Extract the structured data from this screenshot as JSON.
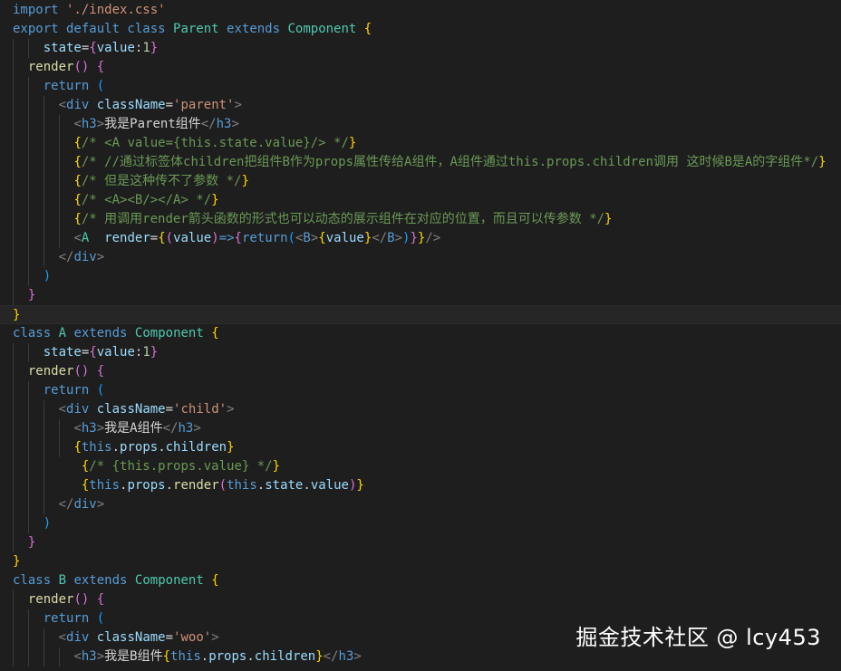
{
  "editor": {
    "colors": {
      "background": "#1e1e1e",
      "keyword": "#569cd6",
      "class": "#4ec9b0",
      "function": "#dcdcaa",
      "variable": "#9cdcfe",
      "number": "#b5cea8",
      "string": "#ce9178",
      "comment": "#6a9955",
      "bracket_gold": "#ffd700",
      "bracket_purple": "#da70d6",
      "bracket_blue": "#179fff"
    },
    "lines": [
      {
        "indent": 0,
        "tokens": [
          [
            "keyword",
            "import"
          ],
          [
            "text",
            " "
          ],
          [
            "str",
            "'./index.css'"
          ]
        ]
      },
      {
        "indent": 0,
        "tokens": [
          [
            "keyword",
            "export default class"
          ],
          [
            "text",
            " "
          ],
          [
            "class",
            "Parent"
          ],
          [
            "text",
            " "
          ],
          [
            "keyword",
            "extends"
          ],
          [
            "text",
            " "
          ],
          [
            "class",
            "Component"
          ],
          [
            "text",
            " "
          ],
          [
            "brace1",
            "{"
          ]
        ]
      },
      {
        "indent": 2,
        "tokens": [
          [
            "var",
            "state"
          ],
          [
            "op",
            "="
          ],
          [
            "brace2",
            "{"
          ],
          [
            "var",
            "value"
          ],
          [
            "op",
            ":"
          ],
          [
            "num",
            "1"
          ],
          [
            "brace2",
            "}"
          ]
        ]
      },
      {
        "indent": 1,
        "tokens": [
          [
            "func",
            "render"
          ],
          [
            "brace2",
            "()"
          ],
          [
            "text",
            " "
          ],
          [
            "brace2",
            "{"
          ]
        ]
      },
      {
        "indent": 2,
        "tokens": [
          [
            "keyword",
            "return"
          ],
          [
            "text",
            " "
          ],
          [
            "brace3",
            "("
          ]
        ]
      },
      {
        "indent": 3,
        "tokens": [
          [
            "tag",
            "<"
          ],
          [
            "tagname",
            "div"
          ],
          [
            "text",
            " "
          ],
          [
            "attr",
            "className"
          ],
          [
            "op",
            "="
          ],
          [
            "str",
            "'parent'"
          ],
          [
            "tag",
            ">"
          ]
        ]
      },
      {
        "indent": 4,
        "tokens": [
          [
            "tag",
            "<"
          ],
          [
            "tagname",
            "h3"
          ],
          [
            "tag",
            ">"
          ],
          [
            "text",
            "我是Parent组件"
          ],
          [
            "tag",
            "</"
          ],
          [
            "tagname",
            "h3"
          ],
          [
            "tag",
            ">"
          ]
        ]
      },
      {
        "indent": 4,
        "tokens": [
          [
            "brace1",
            "{"
          ],
          [
            "comment",
            "/* <A value={this.state.value}/> */"
          ],
          [
            "brace1",
            "}"
          ]
        ]
      },
      {
        "indent": 4,
        "tokens": [
          [
            "brace1",
            "{"
          ],
          [
            "comment",
            "/* //通过标签体children把组件B作为props属性传给A组件，A组件通过this.props.children调用 这时候B是A的字组件*/"
          ],
          [
            "brace1",
            "}"
          ]
        ]
      },
      {
        "indent": 4,
        "tokens": [
          [
            "brace1",
            "{"
          ],
          [
            "comment",
            "/* 但是这种传不了参数 */"
          ],
          [
            "brace1",
            "}"
          ]
        ]
      },
      {
        "indent": 4,
        "tokens": [
          [
            "brace1",
            "{"
          ],
          [
            "comment",
            "/* <A><B/></A> */"
          ],
          [
            "brace1",
            "}"
          ]
        ]
      },
      {
        "indent": 4,
        "tokens": [
          [
            "brace1",
            "{"
          ],
          [
            "comment",
            "/* 用调用render箭头函数的形式也可以动态的展示组件在对应的位置，而且可以传参数 */"
          ],
          [
            "brace1",
            "}"
          ]
        ]
      },
      {
        "indent": 4,
        "tokens": [
          [
            "tag",
            "<"
          ],
          [
            "class",
            "A"
          ],
          [
            "text",
            "  "
          ],
          [
            "attr",
            "render"
          ],
          [
            "op",
            "="
          ],
          [
            "brace1",
            "{"
          ],
          [
            "brace2",
            "("
          ],
          [
            "var",
            "value"
          ],
          [
            "brace2",
            ")"
          ],
          [
            "keyword",
            "=>"
          ],
          [
            "brace2",
            "{"
          ],
          [
            "keyword",
            "return"
          ],
          [
            "brace3",
            "("
          ],
          [
            "tag",
            "<"
          ],
          [
            "tagname",
            "B"
          ],
          [
            "tag",
            ">"
          ],
          [
            "brace1",
            "{"
          ],
          [
            "var",
            "value"
          ],
          [
            "brace1",
            "}"
          ],
          [
            "tag",
            "</"
          ],
          [
            "tagname",
            "B"
          ],
          [
            "tag",
            ">"
          ],
          [
            "brace3",
            ")"
          ],
          [
            "brace2",
            "}"
          ],
          [
            "brace1",
            "}"
          ],
          [
            "tag",
            "/>"
          ]
        ]
      },
      {
        "indent": 3,
        "tokens": [
          [
            "tag",
            "</"
          ],
          [
            "tagname",
            "div"
          ],
          [
            "tag",
            ">"
          ]
        ]
      },
      {
        "indent": 2,
        "tokens": [
          [
            "brace3",
            ")"
          ]
        ]
      },
      {
        "indent": 1,
        "tokens": [
          [
            "brace2",
            "}"
          ]
        ]
      },
      {
        "indent": 0,
        "current": true,
        "tokens": [
          [
            "brace1",
            "}"
          ]
        ]
      },
      {
        "indent": 0,
        "tokens": [
          [
            "keyword",
            "class"
          ],
          [
            "text",
            " "
          ],
          [
            "class",
            "A"
          ],
          [
            "text",
            " "
          ],
          [
            "keyword",
            "extends"
          ],
          [
            "text",
            " "
          ],
          [
            "class",
            "Component"
          ],
          [
            "text",
            " "
          ],
          [
            "brace1",
            "{"
          ]
        ]
      },
      {
        "indent": 2,
        "tokens": [
          [
            "var",
            "state"
          ],
          [
            "op",
            "="
          ],
          [
            "brace2",
            "{"
          ],
          [
            "var",
            "value"
          ],
          [
            "op",
            ":"
          ],
          [
            "num",
            "1"
          ],
          [
            "brace2",
            "}"
          ]
        ]
      },
      {
        "indent": 1,
        "tokens": [
          [
            "func",
            "render"
          ],
          [
            "brace2",
            "()"
          ],
          [
            "text",
            " "
          ],
          [
            "brace2",
            "{"
          ]
        ]
      },
      {
        "indent": 2,
        "tokens": [
          [
            "keyword",
            "return"
          ],
          [
            "text",
            " "
          ],
          [
            "brace3",
            "("
          ]
        ]
      },
      {
        "indent": 3,
        "tokens": [
          [
            "tag",
            "<"
          ],
          [
            "tagname",
            "div"
          ],
          [
            "text",
            " "
          ],
          [
            "attr",
            "className"
          ],
          [
            "op",
            "="
          ],
          [
            "str",
            "'child'"
          ],
          [
            "tag",
            ">"
          ]
        ]
      },
      {
        "indent": 4,
        "tokens": [
          [
            "tag",
            "<"
          ],
          [
            "tagname",
            "h3"
          ],
          [
            "tag",
            ">"
          ],
          [
            "text",
            "我是A组件"
          ],
          [
            "tag",
            "</"
          ],
          [
            "tagname",
            "h3"
          ],
          [
            "tag",
            ">"
          ]
        ]
      },
      {
        "indent": 4,
        "tokens": [
          [
            "brace1",
            "{"
          ],
          [
            "keyword",
            "this"
          ],
          [
            "op",
            "."
          ],
          [
            "var",
            "props"
          ],
          [
            "op",
            "."
          ],
          [
            "var",
            "children"
          ],
          [
            "brace1",
            "}"
          ]
        ]
      },
      {
        "indent": 3,
        "extra": "   ",
        "tokens": [
          [
            "brace1",
            "{"
          ],
          [
            "comment",
            "/* {this.props.value} */"
          ],
          [
            "brace1",
            "}"
          ]
        ]
      },
      {
        "indent": 3,
        "extra": "   ",
        "tokens": [
          [
            "brace1",
            "{"
          ],
          [
            "keyword",
            "this"
          ],
          [
            "op",
            "."
          ],
          [
            "var",
            "props"
          ],
          [
            "op",
            "."
          ],
          [
            "func",
            "render"
          ],
          [
            "brace2",
            "("
          ],
          [
            "keyword",
            "this"
          ],
          [
            "op",
            "."
          ],
          [
            "var",
            "state"
          ],
          [
            "op",
            "."
          ],
          [
            "var",
            "value"
          ],
          [
            "brace2",
            ")"
          ],
          [
            "brace1",
            "}"
          ]
        ]
      },
      {
        "indent": 3,
        "tokens": [
          [
            "tag",
            "</"
          ],
          [
            "tagname",
            "div"
          ],
          [
            "tag",
            ">"
          ]
        ]
      },
      {
        "indent": 2,
        "tokens": [
          [
            "brace3",
            ")"
          ]
        ]
      },
      {
        "indent": 1,
        "tokens": [
          [
            "brace2",
            "}"
          ]
        ]
      },
      {
        "indent": 0,
        "tokens": [
          [
            "brace1",
            "}"
          ]
        ]
      },
      {
        "indent": 0,
        "tokens": [
          [
            "keyword",
            "class"
          ],
          [
            "text",
            " "
          ],
          [
            "class",
            "B"
          ],
          [
            "text",
            " "
          ],
          [
            "keyword",
            "extends"
          ],
          [
            "text",
            " "
          ],
          [
            "class",
            "Component"
          ],
          [
            "text",
            " "
          ],
          [
            "brace1",
            "{"
          ]
        ]
      },
      {
        "indent": 1,
        "tokens": [
          [
            "func",
            "render"
          ],
          [
            "brace2",
            "()"
          ],
          [
            "text",
            " "
          ],
          [
            "brace2",
            "{"
          ]
        ]
      },
      {
        "indent": 2,
        "tokens": [
          [
            "keyword",
            "return"
          ],
          [
            "text",
            " "
          ],
          [
            "brace3",
            "("
          ]
        ]
      },
      {
        "indent": 3,
        "tokens": [
          [
            "tag",
            "<"
          ],
          [
            "tagname",
            "div"
          ],
          [
            "text",
            " "
          ],
          [
            "attr",
            "className"
          ],
          [
            "op",
            "="
          ],
          [
            "str",
            "'woo'"
          ],
          [
            "tag",
            ">"
          ]
        ]
      },
      {
        "indent": 4,
        "tokens": [
          [
            "tag",
            "<"
          ],
          [
            "tagname",
            "h3"
          ],
          [
            "tag",
            ">"
          ],
          [
            "text",
            "我是B组件"
          ],
          [
            "brace1",
            "{"
          ],
          [
            "keyword",
            "this"
          ],
          [
            "op",
            "."
          ],
          [
            "var",
            "props"
          ],
          [
            "op",
            "."
          ],
          [
            "var",
            "children"
          ],
          [
            "brace1",
            "}"
          ],
          [
            "tag",
            "</"
          ],
          [
            "tagname",
            "h3"
          ],
          [
            "tag",
            ">"
          ]
        ]
      }
    ]
  },
  "watermark": {
    "text": "掘金技术社区 @ lcy453"
  }
}
